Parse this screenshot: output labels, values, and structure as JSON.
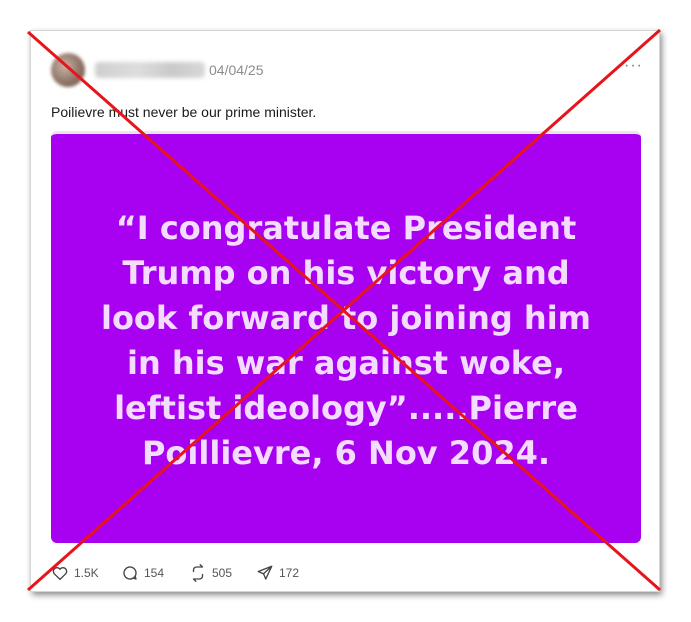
{
  "post": {
    "date": "04/04/25",
    "more_label": "···",
    "text": "Poilievre must never be our prime minister.",
    "image_lines": [
      "“I congratulate President",
      "Trump on his victory and",
      "look forward to joining him",
      "in his war against woke,",
      "leftist ideology”.....Pierre",
      "Poillievre, 6 Nov 2024."
    ],
    "image_bg_color": "#a800f0"
  },
  "actions": {
    "likes": "1.5K",
    "replies": "154",
    "reposts": "505",
    "shares": "172"
  },
  "overlay": {
    "cross_color": "#e8141b"
  }
}
